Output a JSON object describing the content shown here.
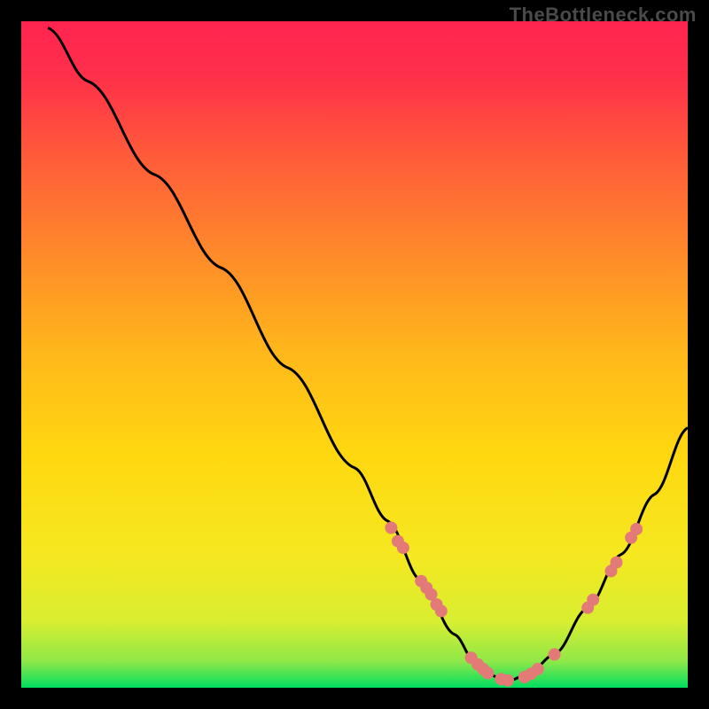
{
  "attribution": "TheBottleneck.com",
  "chart_data": {
    "type": "line",
    "title": "",
    "xlabel": "",
    "ylabel": "",
    "xlim": [
      0,
      100
    ],
    "ylim": [
      0,
      100
    ],
    "background_gradient": {
      "top": "#ff2450",
      "middle": "#ffd800",
      "bottom": "#00e060"
    },
    "curve": {
      "description": "V-shaped bottleneck curve descending from top-left, reaching minimum near x≈73, then rising toward right edge",
      "points": [
        {
          "x": 4,
          "y": 99
        },
        {
          "x": 10,
          "y": 91
        },
        {
          "x": 20,
          "y": 77
        },
        {
          "x": 30,
          "y": 63
        },
        {
          "x": 40,
          "y": 48
        },
        {
          "x": 50,
          "y": 33
        },
        {
          "x": 55,
          "y": 25
        },
        {
          "x": 60,
          "y": 16
        },
        {
          "x": 65,
          "y": 8
        },
        {
          "x": 68,
          "y": 4
        },
        {
          "x": 70,
          "y": 2
        },
        {
          "x": 73,
          "y": 1
        },
        {
          "x": 76,
          "y": 2
        },
        {
          "x": 80,
          "y": 5
        },
        {
          "x": 85,
          "y": 12
        },
        {
          "x": 90,
          "y": 20
        },
        {
          "x": 95,
          "y": 29
        },
        {
          "x": 100,
          "y": 39
        }
      ]
    },
    "markers": {
      "color": "#e47a78",
      "points": [
        {
          "x": 55.5,
          "y": 24
        },
        {
          "x": 56.5,
          "y": 22
        },
        {
          "x": 57.3,
          "y": 21
        },
        {
          "x": 60.0,
          "y": 16
        },
        {
          "x": 60.8,
          "y": 15
        },
        {
          "x": 61.5,
          "y": 14
        },
        {
          "x": 62.3,
          "y": 12.5
        },
        {
          "x": 63.0,
          "y": 11.5
        },
        {
          "x": 67.5,
          "y": 4.5
        },
        {
          "x": 68.5,
          "y": 3.5
        },
        {
          "x": 69.3,
          "y": 2.8
        },
        {
          "x": 70.0,
          "y": 2.2
        },
        {
          "x": 72.0,
          "y": 1.3
        },
        {
          "x": 73.0,
          "y": 1.1
        },
        {
          "x": 75.5,
          "y": 1.6
        },
        {
          "x": 76.5,
          "y": 2.1
        },
        {
          "x": 77.5,
          "y": 2.8
        },
        {
          "x": 80.0,
          "y": 5.0
        },
        {
          "x": 85.0,
          "y": 12.0
        },
        {
          "x": 85.8,
          "y": 13.2
        },
        {
          "x": 88.5,
          "y": 17.5
        },
        {
          "x": 89.3,
          "y": 18.8
        },
        {
          "x": 91.5,
          "y": 22.5
        },
        {
          "x": 92.3,
          "y": 23.8
        }
      ]
    }
  }
}
